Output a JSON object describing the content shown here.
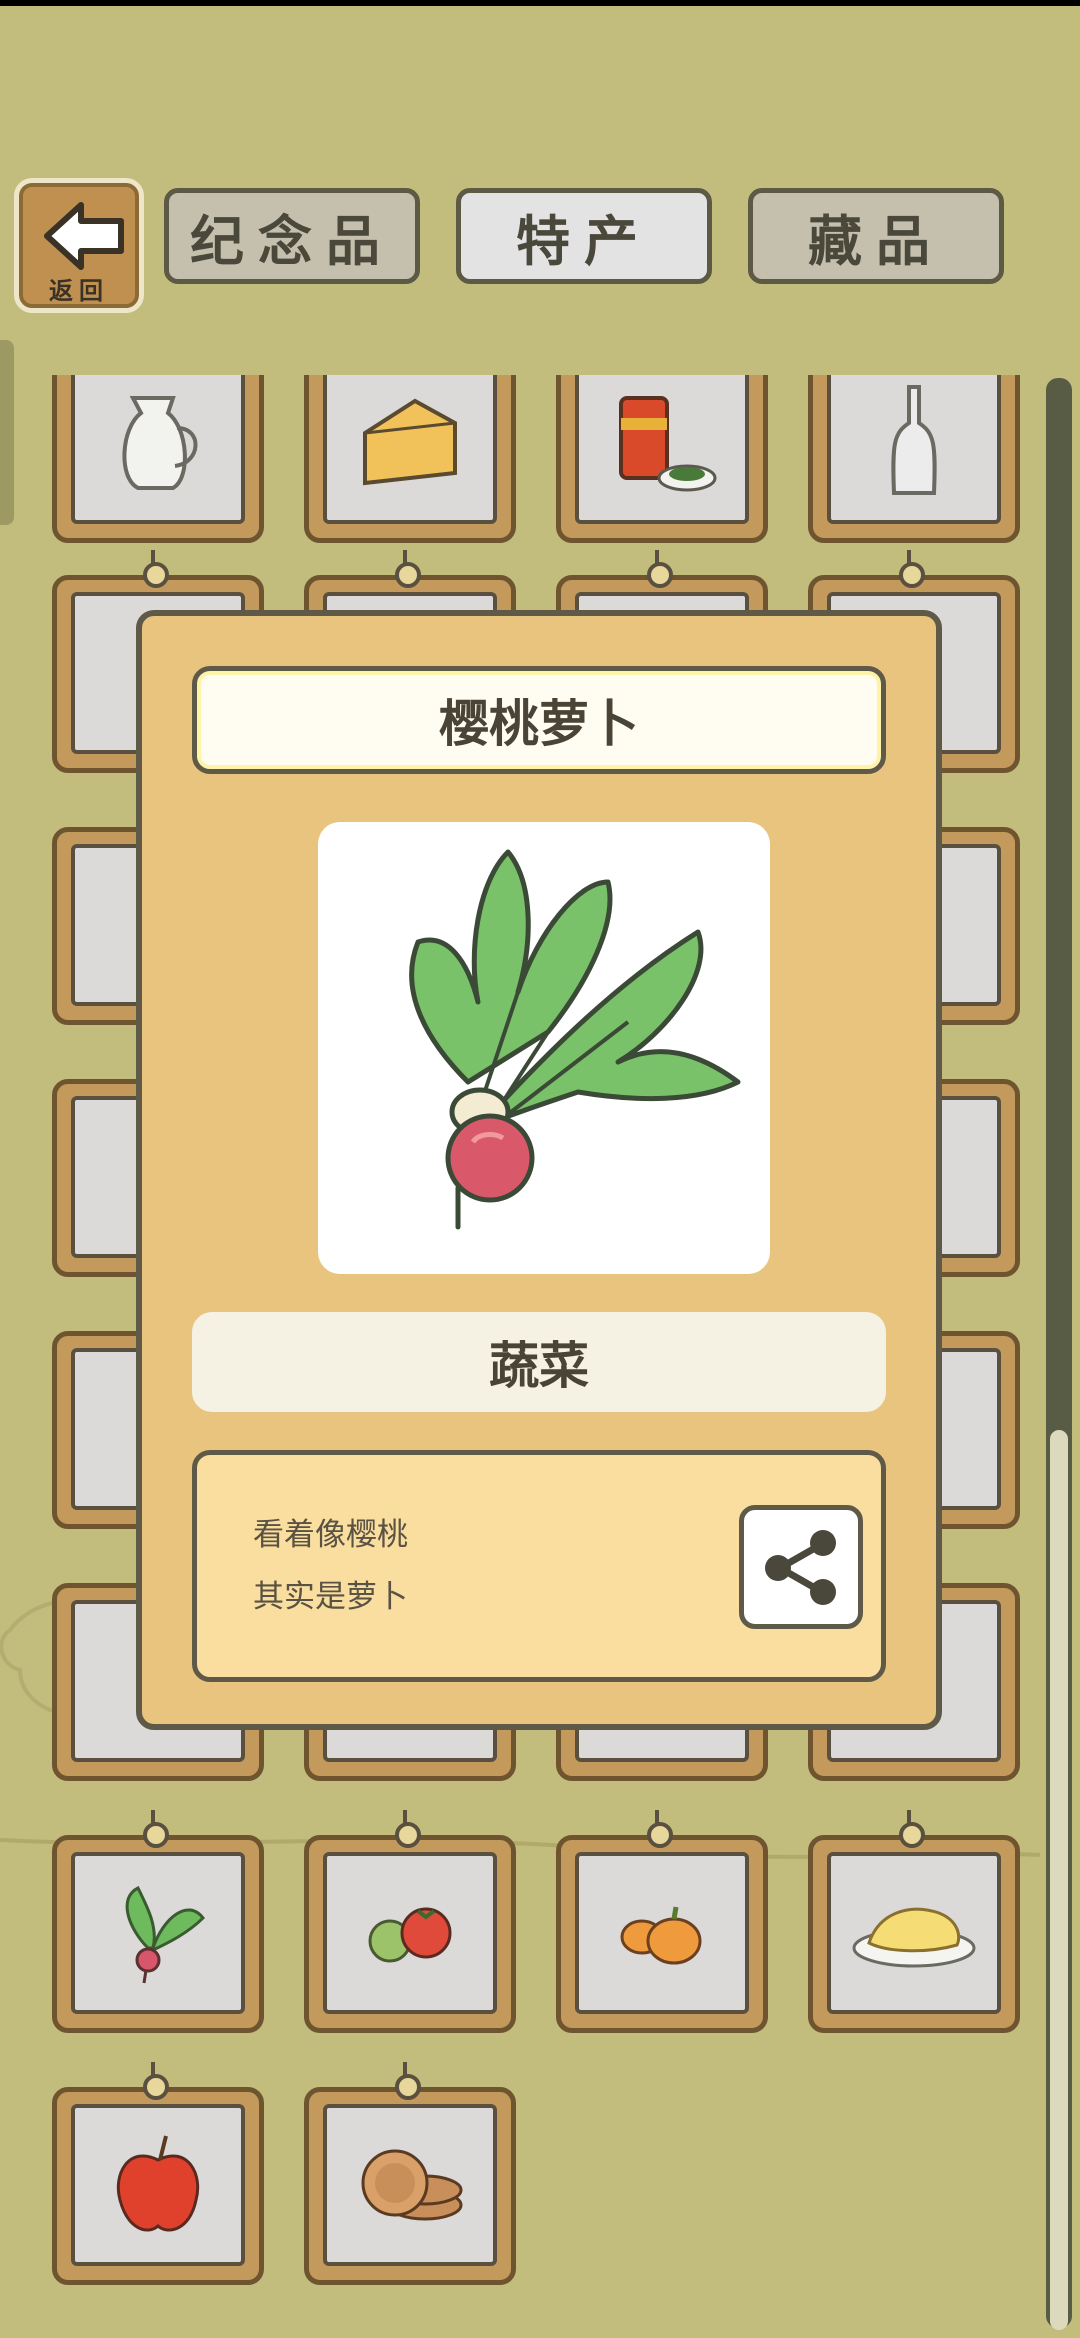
{
  "header": {
    "back_label": "返回",
    "tabs": [
      {
        "label": "纪念品",
        "active": false
      },
      {
        "label": "特产",
        "active": true
      },
      {
        "label": "藏品",
        "active": false
      }
    ]
  },
  "grid": {
    "items": [
      {
        "name": "milk-jug-icon"
      },
      {
        "name": "cheese-icon"
      },
      {
        "name": "tea-can-icon"
      },
      {
        "name": "glass-bottle-icon"
      },
      {
        "name": "item-hidden"
      },
      {
        "name": "item-hidden"
      },
      {
        "name": "item-hidden"
      },
      {
        "name": "item-hidden"
      },
      {
        "name": "item-hidden"
      },
      {
        "name": "item-hidden"
      },
      {
        "name": "item-hidden"
      },
      {
        "name": "item-hidden"
      },
      {
        "name": "item-hidden"
      },
      {
        "name": "item-hidden"
      },
      {
        "name": "item-hidden"
      },
      {
        "name": "item-hidden"
      },
      {
        "name": "item-hidden"
      },
      {
        "name": "item-hidden"
      },
      {
        "name": "item-hidden"
      },
      {
        "name": "item-hidden"
      },
      {
        "name": "item-hidden"
      },
      {
        "name": "item-hidden"
      },
      {
        "name": "item-hidden"
      },
      {
        "name": "item-hidden"
      },
      {
        "name": "radish-icon"
      },
      {
        "name": "tomato-icon"
      },
      {
        "name": "pumpkin-icon"
      },
      {
        "name": "pasta-plate-icon"
      },
      {
        "name": "apple-icon"
      },
      {
        "name": "pancake-stack-icon"
      }
    ]
  },
  "popup": {
    "title": "樱桃萝卜",
    "category": "蔬菜",
    "description_lines": [
      "看着像樱桃",
      "其实是萝卜"
    ],
    "share_icon": "share-icon"
  },
  "colors": {
    "background": "#c2bd7c",
    "popup": "#e8c47e",
    "frame_wood": "#c49a5c",
    "border": "#5f5a48"
  }
}
